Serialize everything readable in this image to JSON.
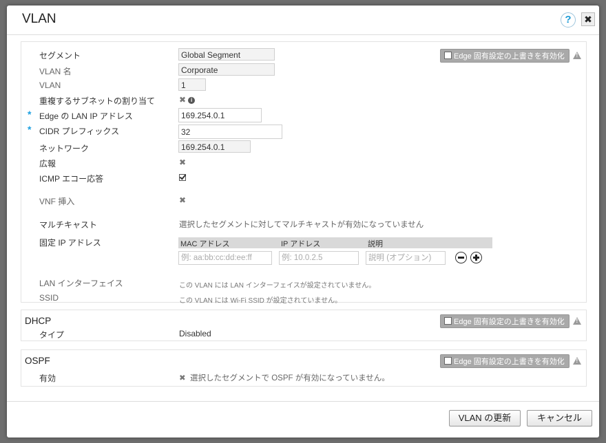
{
  "dialog": {
    "title": "VLAN"
  },
  "override_label": "Edge 固有設定の上書きを有効化",
  "main": {
    "segment_label": "セグメント",
    "segment_value": "Global Segment",
    "vlan_name_label": "VLAN 名",
    "vlan_name_value": "Corporate",
    "vlan_label": "VLAN",
    "vlan_value": "1",
    "overlap_label": "重複するサブネットの割り当て",
    "edge_lan_ip_label": "Edge の LAN IP アドレス",
    "edge_lan_ip_value": "169.254.0.1",
    "cidr_label": "CIDR プレフィックス",
    "cidr_value": "32",
    "network_label": "ネットワーク",
    "network_value": "169.254.0.1",
    "broadcast_label": "広報",
    "icmp_label": "ICMP エコー応答",
    "vnf_label": "VNF 挿入",
    "multicast_label": "マルチキャスト",
    "multicast_value": "選択したセグメントに対してマルチキャストが有効になっていません",
    "static_ip_label": "固定 IP アドレス",
    "table_headers": [
      "MAC アドレス",
      "IP アドレス",
      "説明"
    ],
    "mac_placeholder": "例: aa:bb:cc:dd:ee:ff",
    "ip_placeholder": "例: 10.0.2.5",
    "desc_placeholder": "説明 (オプション)",
    "lan_if_label": "LAN インターフェイス",
    "lan_if_value": "この VLAN には LAN インターフェイスが設定されていません。",
    "ssid_label": "SSID",
    "ssid_value": "この VLAN には Wi-Fi SSID が設定されていません。"
  },
  "dhcp": {
    "title": "DHCP",
    "type_label": "タイプ",
    "type_value": "Disabled"
  },
  "ospf": {
    "title": "OSPF",
    "enabled_label": "有効",
    "enabled_value": "選択したセグメントで OSPF が有効になっていません。"
  },
  "footer": {
    "update_label": "VLAN の更新",
    "cancel_label": "キャンセル"
  },
  "required_mark": "*"
}
